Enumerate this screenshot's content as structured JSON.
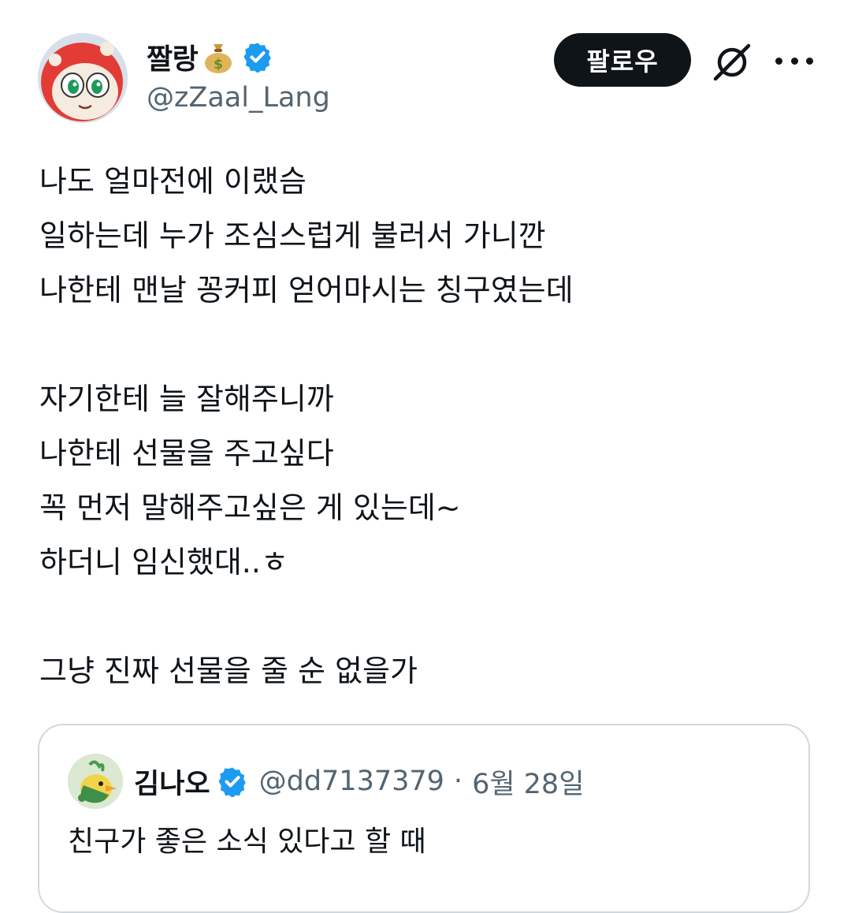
{
  "author": {
    "display_name": "짤랑",
    "handle": "@zZaal_Lang",
    "avatar_icon": "red-cartoon-character-avatar",
    "name_emoji_icon": "money-bag-icon",
    "verified_icon": "verified-badge-icon"
  },
  "actions": {
    "follow_label": "팔로우",
    "grok_icon": "grok-icon",
    "more_icon": "more-icon"
  },
  "tweet": {
    "lines": [
      "나도 얼마전에 이랬슴",
      "일하는데 누가 조심스럽게 불러서 가니깐",
      "나한테 맨날 꽁커피 얻어마시는 칭구였는데",
      "",
      "자기한테 늘 잘해주니까",
      "나한테 선물을 주고싶다",
      "꼭 먼저 말해주고싶은 게 있는데~",
      "하더니 임신했대..ㅎ",
      "",
      "그냥 진짜 선물을 줄 순 없을가"
    ]
  },
  "quote": {
    "display_name": "김나오",
    "handle": "@dd7137379",
    "separator": "·",
    "date": "6월 28일",
    "text": "친구가 좋은 소식 있다고 할 때",
    "avatar_icon": "green-bird-character-avatar"
  },
  "colors": {
    "text_primary": "#0f1419",
    "text_secondary": "#536471",
    "verified_blue": "#1d9bf0",
    "border": "#cfd9de",
    "button_bg": "#0f1419"
  }
}
